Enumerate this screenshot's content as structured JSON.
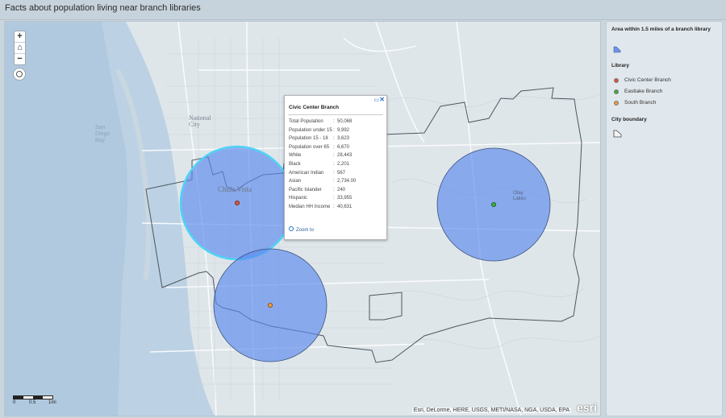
{
  "app": {
    "title": "Facts about population living near branch libraries"
  },
  "map": {
    "controls": {
      "zoom_in": "+",
      "home": "⌂",
      "zoom_out": "−"
    },
    "labels": [
      {
        "text": "Chula Vista",
        "key": "chula"
      },
      {
        "text": "National City",
        "key": "natcity"
      },
      {
        "text": "San Diego Bay",
        "key": "bay"
      },
      {
        "text": "Otay Lakes",
        "key": "otay"
      }
    ],
    "scale": {
      "labels": [
        "0",
        "0.5",
        "1mi"
      ]
    },
    "attribution": "Esri, DeLorme, HERE, USGS, METI/NASA, NGA, USDA, EPA",
    "logo": "esri"
  },
  "popup": {
    "title": "Civic Center Branch",
    "rows": [
      {
        "label": "Total Population",
        "value": "50,068"
      },
      {
        "label": "Population under 15",
        "value": "9,992"
      },
      {
        "label": "Population 15 - 18",
        "value": "3,623"
      },
      {
        "label": "Population over 65",
        "value": "6,670"
      },
      {
        "label": "White",
        "value": "28,443"
      },
      {
        "label": "Black",
        "value": "2,201"
      },
      {
        "label": "American Indian",
        "value": "567"
      },
      {
        "label": "Asian",
        "value": "2,734.00"
      },
      {
        "label": "Pacific Islander",
        "value": "240"
      },
      {
        "label": "Hispanic",
        "value": "33,955"
      },
      {
        "label": "Median HH Income",
        "value": "40,631"
      }
    ],
    "zoom_link": "Zoom to",
    "close": "✕",
    "maximize": "▭"
  },
  "legend": {
    "area_heading": "Area within 1.5 miles of a branch library",
    "library_heading": "Library",
    "libraries": [
      {
        "name": "Civic Center Branch",
        "color": "#e0523a"
      },
      {
        "name": "Eastlake Branch",
        "color": "#3cae3c"
      },
      {
        "name": "South Branch",
        "color": "#f09a3e"
      }
    ],
    "city_heading": "City boundary",
    "buffer_color": "#6f93e6"
  }
}
